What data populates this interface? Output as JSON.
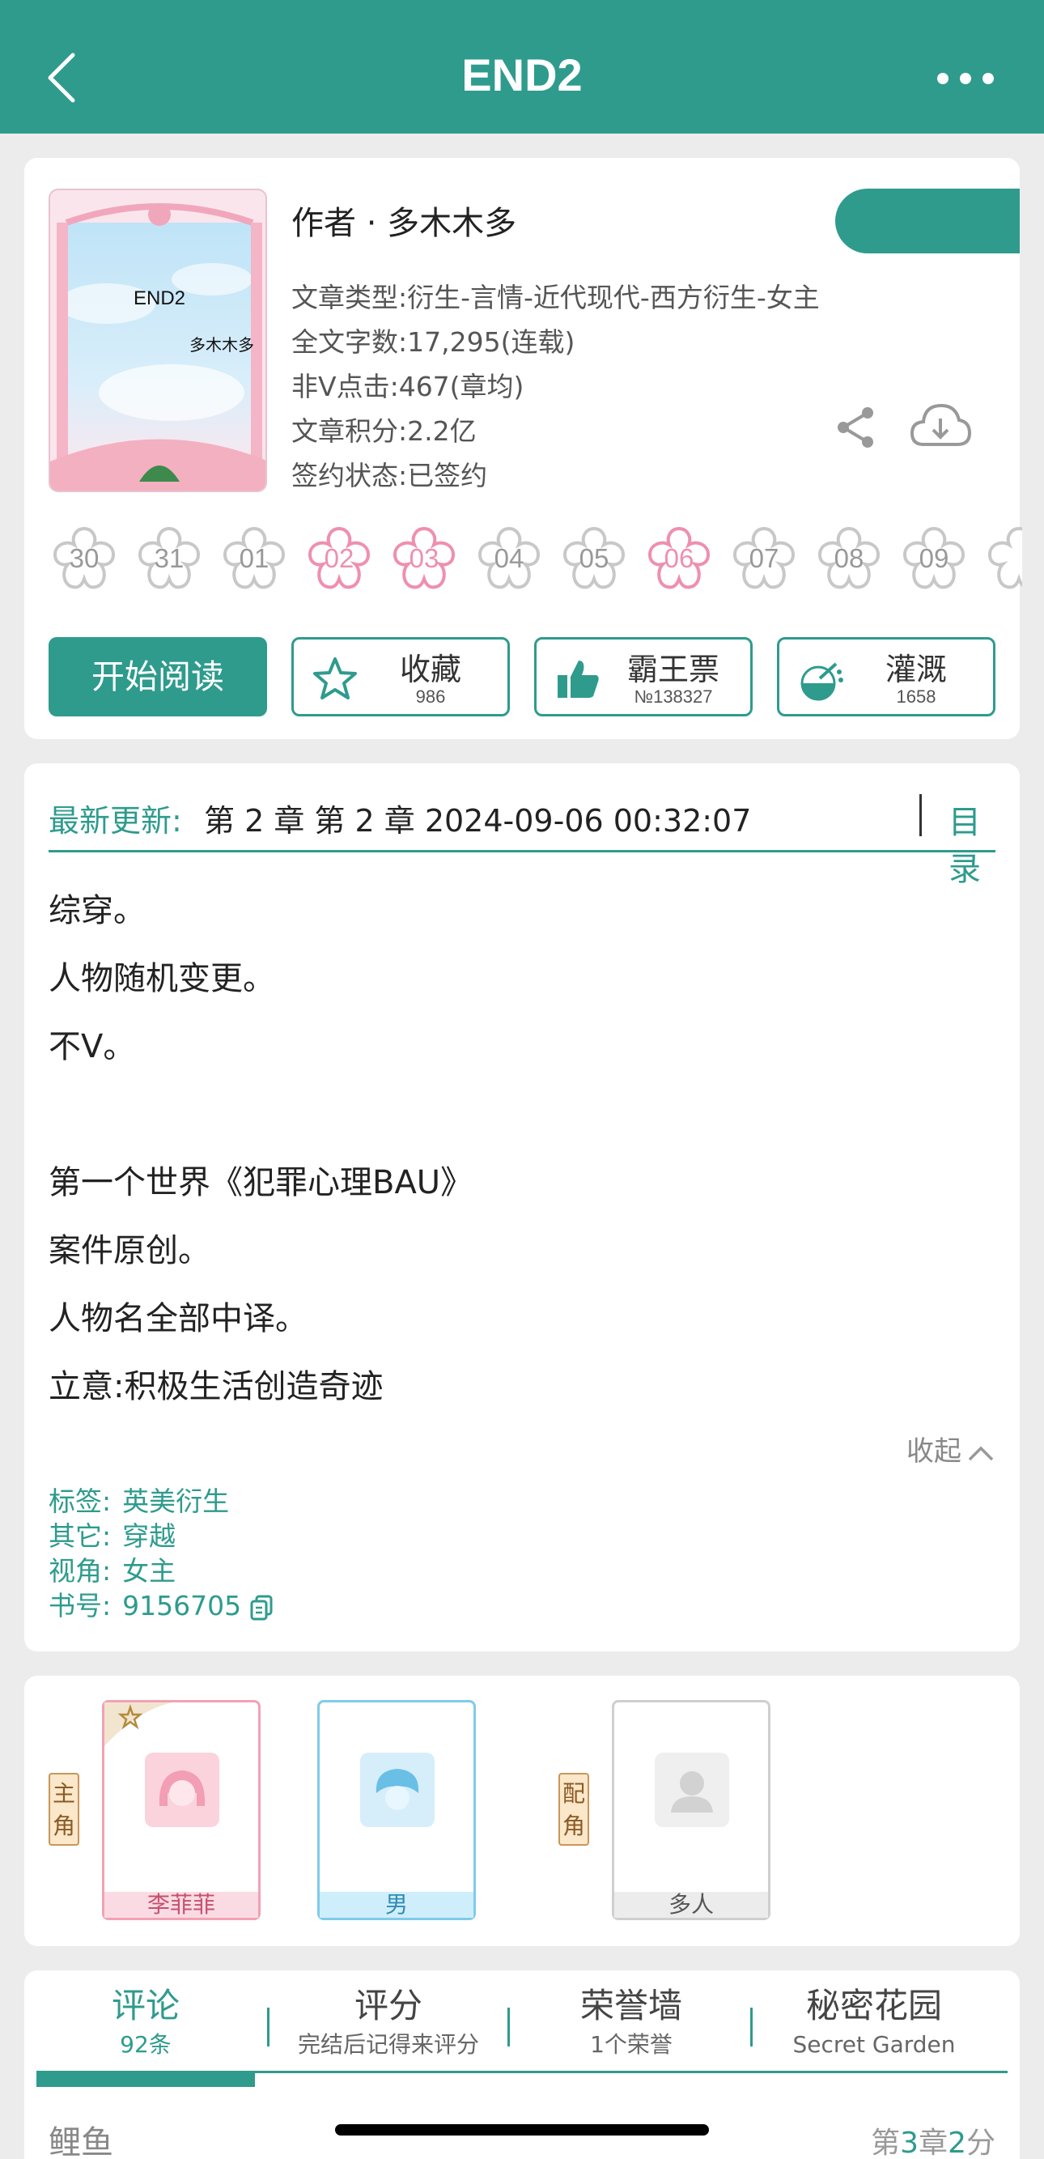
{
  "header": {
    "title": "END2"
  },
  "book": {
    "cover_title": "END2",
    "cover_author": "多木木多",
    "author_line": "作者 · 多木木多",
    "meta": [
      "文章类型:衍生-言情-近代现代-西方衍生-女主",
      "全文字数:17,295(连载)",
      "非Ⅴ点击:467(章均)",
      "文章积分:2.2亿",
      "签约状态:已签约"
    ],
    "calendar_days": [
      {
        "d": "30",
        "active": false
      },
      {
        "d": "31",
        "active": false
      },
      {
        "d": "01",
        "active": false
      },
      {
        "d": "02",
        "active": true
      },
      {
        "d": "03",
        "active": true
      },
      {
        "d": "04",
        "active": false
      },
      {
        "d": "05",
        "active": false
      },
      {
        "d": "06",
        "active": true
      },
      {
        "d": "07",
        "active": false
      },
      {
        "d": "08",
        "active": false
      },
      {
        "d": "09",
        "active": false
      }
    ],
    "buttons": {
      "read": "开始阅读",
      "favorite": {
        "label": "收藏",
        "count": "986"
      },
      "vote": {
        "label": "霸王票",
        "count": "№138327"
      },
      "water": {
        "label": "灌溉",
        "count": "1658"
      }
    }
  },
  "update": {
    "label": "最新更新:",
    "text": "第 2 章 第 2 章 2024-09-06 00:32:07",
    "toc": "目录"
  },
  "intro": {
    "lines": [
      "综穿。",
      "人物随机变更。",
      "不Ⅴ。",
      "",
      "第一个世界《犯罪心理BAU》",
      "案件原创。",
      "人物名全部中译。",
      "立意:积极生活创造奇迹"
    ],
    "collapse": "收起"
  },
  "tags": [
    {
      "k": "标签:",
      "v": "英美衍生"
    },
    {
      "k": "其它:",
      "v": "穿越"
    },
    {
      "k": "视角:",
      "v": "女主"
    },
    {
      "k": "书号:",
      "v": "9156705"
    }
  ],
  "characters": {
    "main_tag": "主角",
    "side_tag": "配角",
    "list": [
      {
        "name": "李菲菲",
        "role": "main",
        "color": "#f2a1b6"
      },
      {
        "name": "男",
        "role": "main",
        "color": "#7fcbea"
      },
      {
        "name": "多人",
        "role": "side",
        "color": "#c9c9c9"
      }
    ]
  },
  "tabs": [
    {
      "label": "评论",
      "sub": "92条"
    },
    {
      "label": "评分",
      "sub": "完结后记得来评分"
    },
    {
      "label": "荣誉墙",
      "sub": "1个荣誉"
    },
    {
      "label": "秘密花园",
      "sub": "Secret Garden"
    }
  ],
  "comment": {
    "author": "鲤鱼",
    "chapter_prefix": "第",
    "chapter": "3",
    "chapter_mid": "章",
    "score": "2",
    "score_suffix": "分"
  },
  "colors": {
    "accent": "#2e9b8d",
    "pink": "#ef8fb0"
  }
}
